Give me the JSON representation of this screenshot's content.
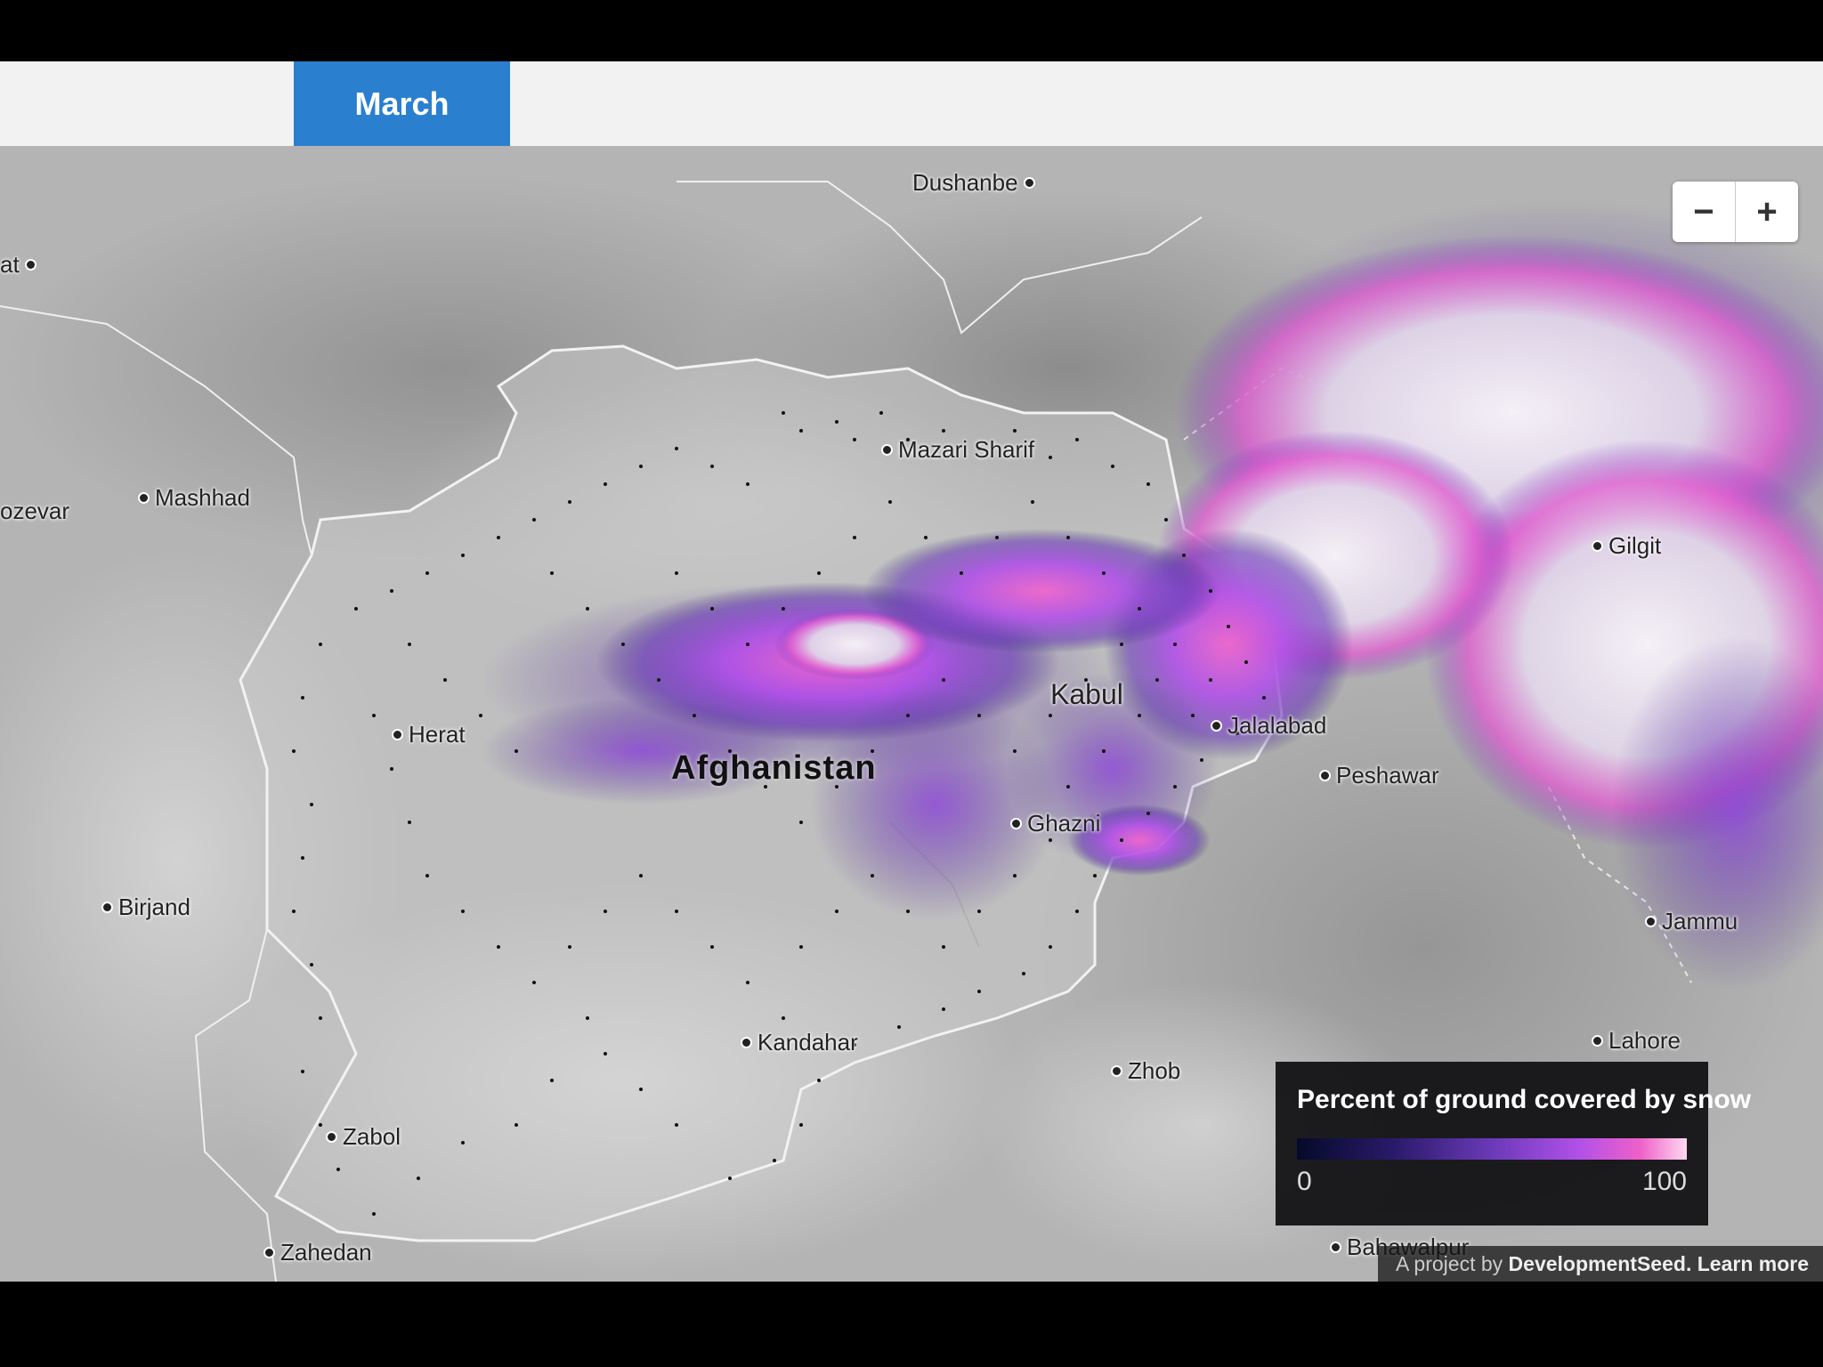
{
  "tabs": [
    {
      "label": ""
    },
    {
      "label": "March"
    },
    {
      "label": ""
    },
    {
      "label": ""
    },
    {
      "label": ""
    },
    {
      "label": ""
    }
  ],
  "zoom": {
    "zoom_out_label": "−",
    "zoom_in_label": "+"
  },
  "map": {
    "country_label": "Afghanistan",
    "places": [
      {
        "name": "Dushanbe"
      },
      {
        "name": "at"
      },
      {
        "name": "Mashhad"
      },
      {
        "name": "ozevar"
      },
      {
        "name": "Mazari Sharif"
      },
      {
        "name": "Kabul"
      },
      {
        "name": "Jalalabad"
      },
      {
        "name": "Peshawar"
      },
      {
        "name": "Herat"
      },
      {
        "name": "Ghazni"
      },
      {
        "name": "Gilgit"
      },
      {
        "name": "Birjand"
      },
      {
        "name": "Jammu"
      },
      {
        "name": "Kandahar"
      },
      {
        "name": "Lahore"
      },
      {
        "name": "Zhob"
      },
      {
        "name": "Zabol"
      },
      {
        "name": "Zahedan"
      },
      {
        "name": "Bahawalpur"
      }
    ]
  },
  "legend": {
    "title": "Percent of ground covered by snow",
    "min_label": "0",
    "max_label": "100"
  },
  "attribution": {
    "prefix": "A project by",
    "brand": "DevelopmentSeed.",
    "link": "Learn more"
  },
  "colors": {
    "tab_active": "#2a7fcf",
    "snow_low": "#2a1a6a",
    "snow_mid": "#b050e8",
    "snow_high": "#ffd8f0"
  }
}
